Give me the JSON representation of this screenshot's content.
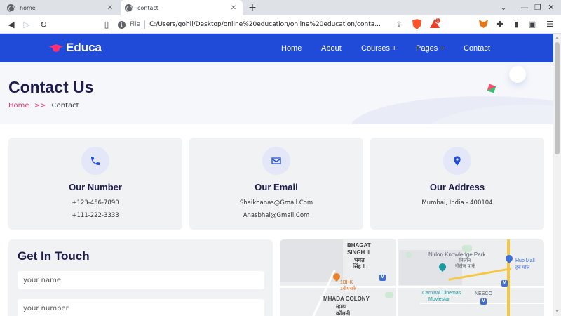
{
  "browser": {
    "tabs": [
      {
        "label": "home",
        "active": false
      },
      {
        "label": "contact",
        "active": true
      }
    ],
    "new_tab_icon": "plus-icon",
    "address": {
      "scheme_label": "File",
      "url": "C:/Users/gohil/Desktop/online%20education/online%20education/conta..."
    },
    "extension_badge": "1"
  },
  "site": {
    "brand": "Educa",
    "nav": [
      "Home",
      "About",
      "Courses +",
      "Pages +",
      "Contact"
    ]
  },
  "header": {
    "title": "Contact Us",
    "breadcrumb": {
      "home": "Home",
      "separator": ">>",
      "current": "Contact"
    }
  },
  "cards": [
    {
      "icon": "phone-icon",
      "title": "Our Number",
      "lines": [
        "+123-456-7890",
        "+111-222-3333"
      ]
    },
    {
      "icon": "envelope-icon",
      "title": "Our Email",
      "lines": [
        "Shaikhanas@Gmail.Com",
        "Anasbhai@Gmail.Com"
      ]
    },
    {
      "icon": "location-pin-icon",
      "title": "Our Address",
      "lines": [
        "Mumbai, India - 400104"
      ]
    }
  ],
  "form": {
    "heading": "Get In Touch",
    "name_placeholder": "your name",
    "number_placeholder": "your number"
  },
  "map": {
    "labels": {
      "bhagat_en": "BHAGAT",
      "singh_en": "SINGH II",
      "bhagat_hi": "भगत",
      "singh_hi": "सिंह II",
      "knowledge_park": "Nirlon Knowledge Park",
      "knowledge_park_hi": "निर्लॉन",
      "knowledge_park_hi2": "नॉलेज पार्क",
      "hub_mall": "Hub Mall",
      "hub_mall_hi": "हब मॉल",
      "bhk": "1BHK",
      "bhk_hi": "1बीएचके",
      "mhada_en": "MHADA COLONY",
      "mhada_hi": "म्हाडा",
      "mhada_hi2": "कॉलनी",
      "carnival": "Carnival Cinemas",
      "movie": "Moviestar",
      "nesco": "NESCO"
    },
    "metro_label": "M"
  }
}
